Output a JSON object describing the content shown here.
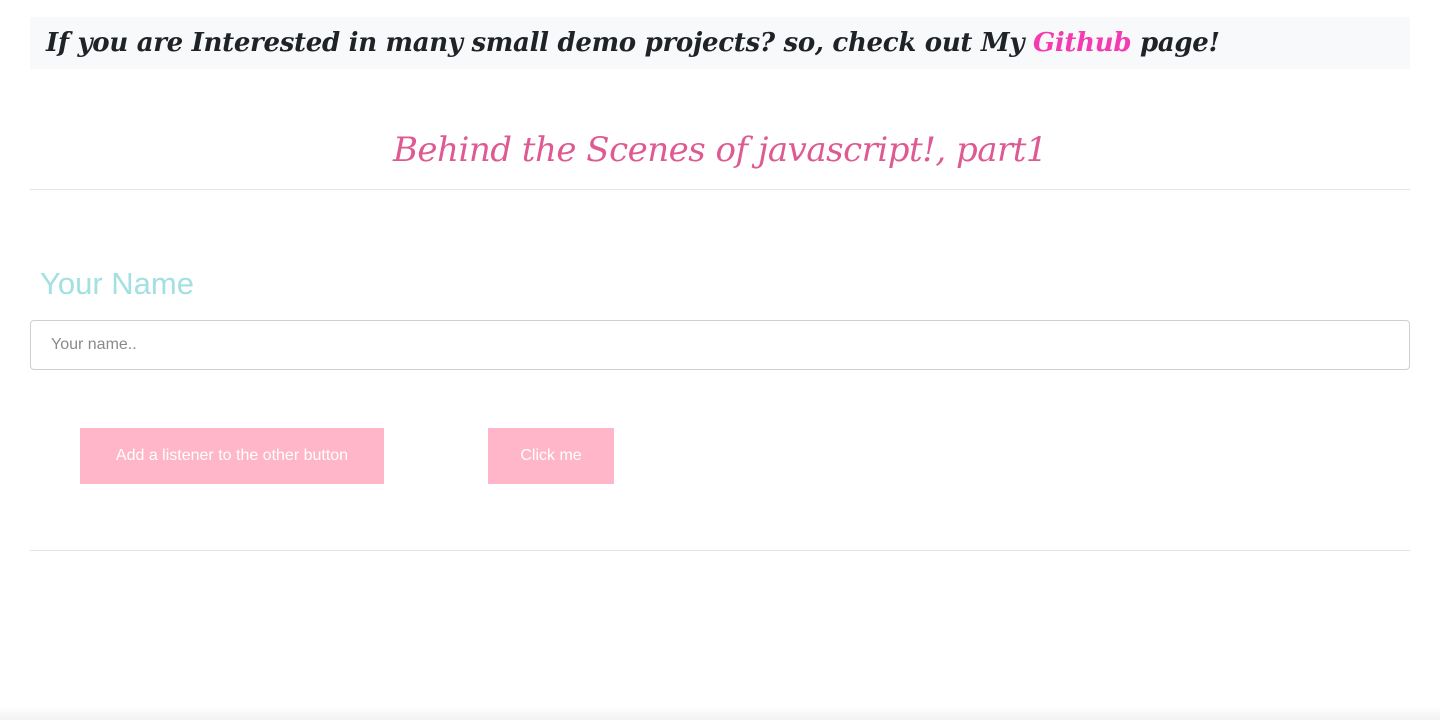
{
  "banner": {
    "text_before": "If you are Interested in many small demo projects? so, check out My ",
    "link_label": "Github",
    "text_after": " page!",
    "link_color": "#f53bb1",
    "background_color": "#f8f9fa"
  },
  "title": {
    "text": "Behind the Scenes of javascript!, part1",
    "color": "#de5a92"
  },
  "form": {
    "label": "Your Name",
    "label_color": "#a3e0e2",
    "input_placeholder": "Your name..",
    "input_value": ""
  },
  "buttons": {
    "listener_label": "Add a listener to the other button",
    "click_label": "Click me",
    "background_color": "#ffb6c8"
  }
}
